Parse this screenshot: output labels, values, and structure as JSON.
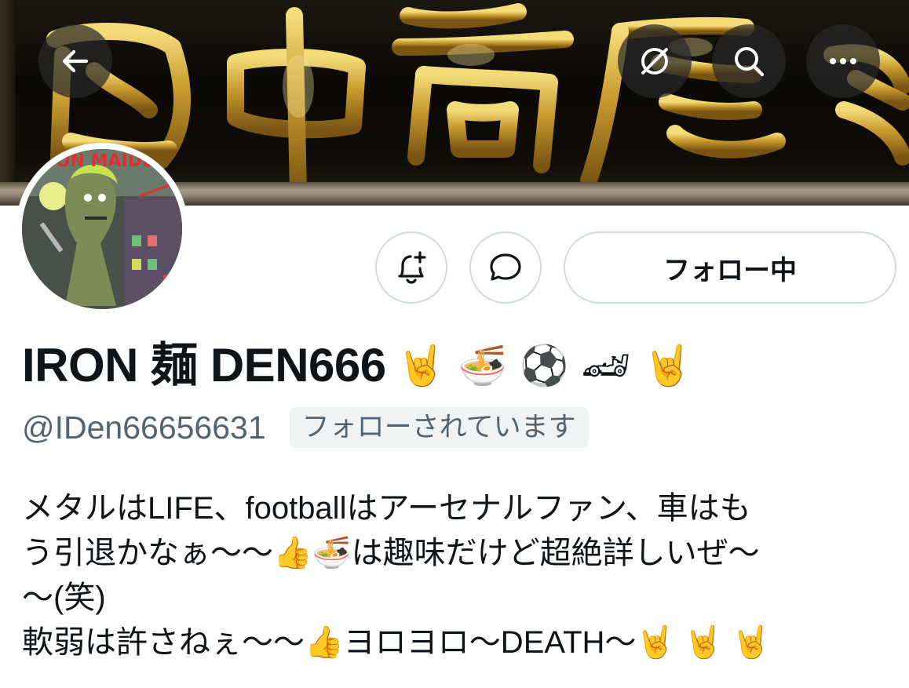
{
  "banner": {
    "description_icons": {
      "back": "arrow-left-icon",
      "translate": "globe-slash-icon",
      "search": "search-icon",
      "more": "more-horizontal-icon"
    },
    "accent_gold": "#c9a227"
  },
  "profile": {
    "display_name": "IRON 麺 DEN666",
    "name_emoji": "🤘 🍜 ⚽ 🏎 🤘",
    "handle": "@IDen66656631",
    "follows_you_label": "フォローされています",
    "following_button_label": "フォロー中",
    "notify_icon": "bell-plus-icon",
    "message_icon": "message-bubble-icon",
    "avatar_text": "IRON MAIDEN"
  },
  "bio": {
    "line1": "メタルはLIFE、footballはアーセナルファン、車はも",
    "line2": "う引退かなぁ〜〜👍🍜は趣味だけど超絶詳しいぜ〜",
    "line3": "〜(笑)",
    "line4": "軟弱は許さねぇ〜〜👍ヨロヨロ〜DEATH〜🤘 🤘 🤘"
  },
  "colors": {
    "text_primary": "#0f1419",
    "text_secondary": "#536471",
    "border": "#cfd9de",
    "badge_bg": "#eff3f4"
  }
}
